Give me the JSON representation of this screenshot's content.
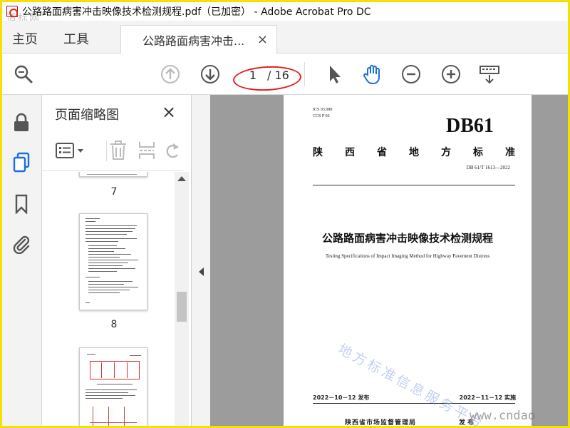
{
  "window": {
    "title": "公路路面病害冲击映像技术检测规程.pdf（已加密） - Adobe Acrobat Pro DC",
    "watermark_top_left": "道标网"
  },
  "tabs": {
    "home": "主页",
    "tools": "工具",
    "document": "公路路面病害冲击...",
    "close": "×"
  },
  "toolbar": {
    "current_page": "1",
    "total_pages": "/ 16",
    "icons": [
      "zoom-search-icon",
      "prev-page-icon",
      "next-page-icon",
      "select-cursor-icon",
      "hand-tool-icon",
      "zoom-out-icon",
      "zoom-in-icon",
      "keyboard-icon"
    ]
  },
  "panel": {
    "title": "页面缩略图",
    "close": "×",
    "thumbnails": [
      {
        "label": "7"
      },
      {
        "label": "8"
      }
    ]
  },
  "document": {
    "ics": "ICS 93.080",
    "ccs": "CCS P 66",
    "code": "DB61",
    "province_chars": [
      "陕",
      "西",
      "省",
      "地",
      "方",
      "标",
      "准"
    ],
    "standard_number": "DB 61/T 1613—2022",
    "title_cn": "公路路面病害冲击映像技术检测规程",
    "title_en": "Testing Specifications of Impact Imaging Method for Highway Pavement Distress",
    "issue_date": "2022－10－12 发布",
    "implement_date": "2022－11－12 实施",
    "issuer": "陕西省市场监督管理局",
    "issuer_suffix": "发 布"
  },
  "watermarks": {
    "diagonal": "地方标准信息服务平台",
    "bottom_right": "www.cndao"
  },
  "colors": {
    "frame_border": "#f5e100",
    "active_blue": "#1a6fd8",
    "annotation_red": "#e02020",
    "doc_background": "#9c9c9c"
  }
}
